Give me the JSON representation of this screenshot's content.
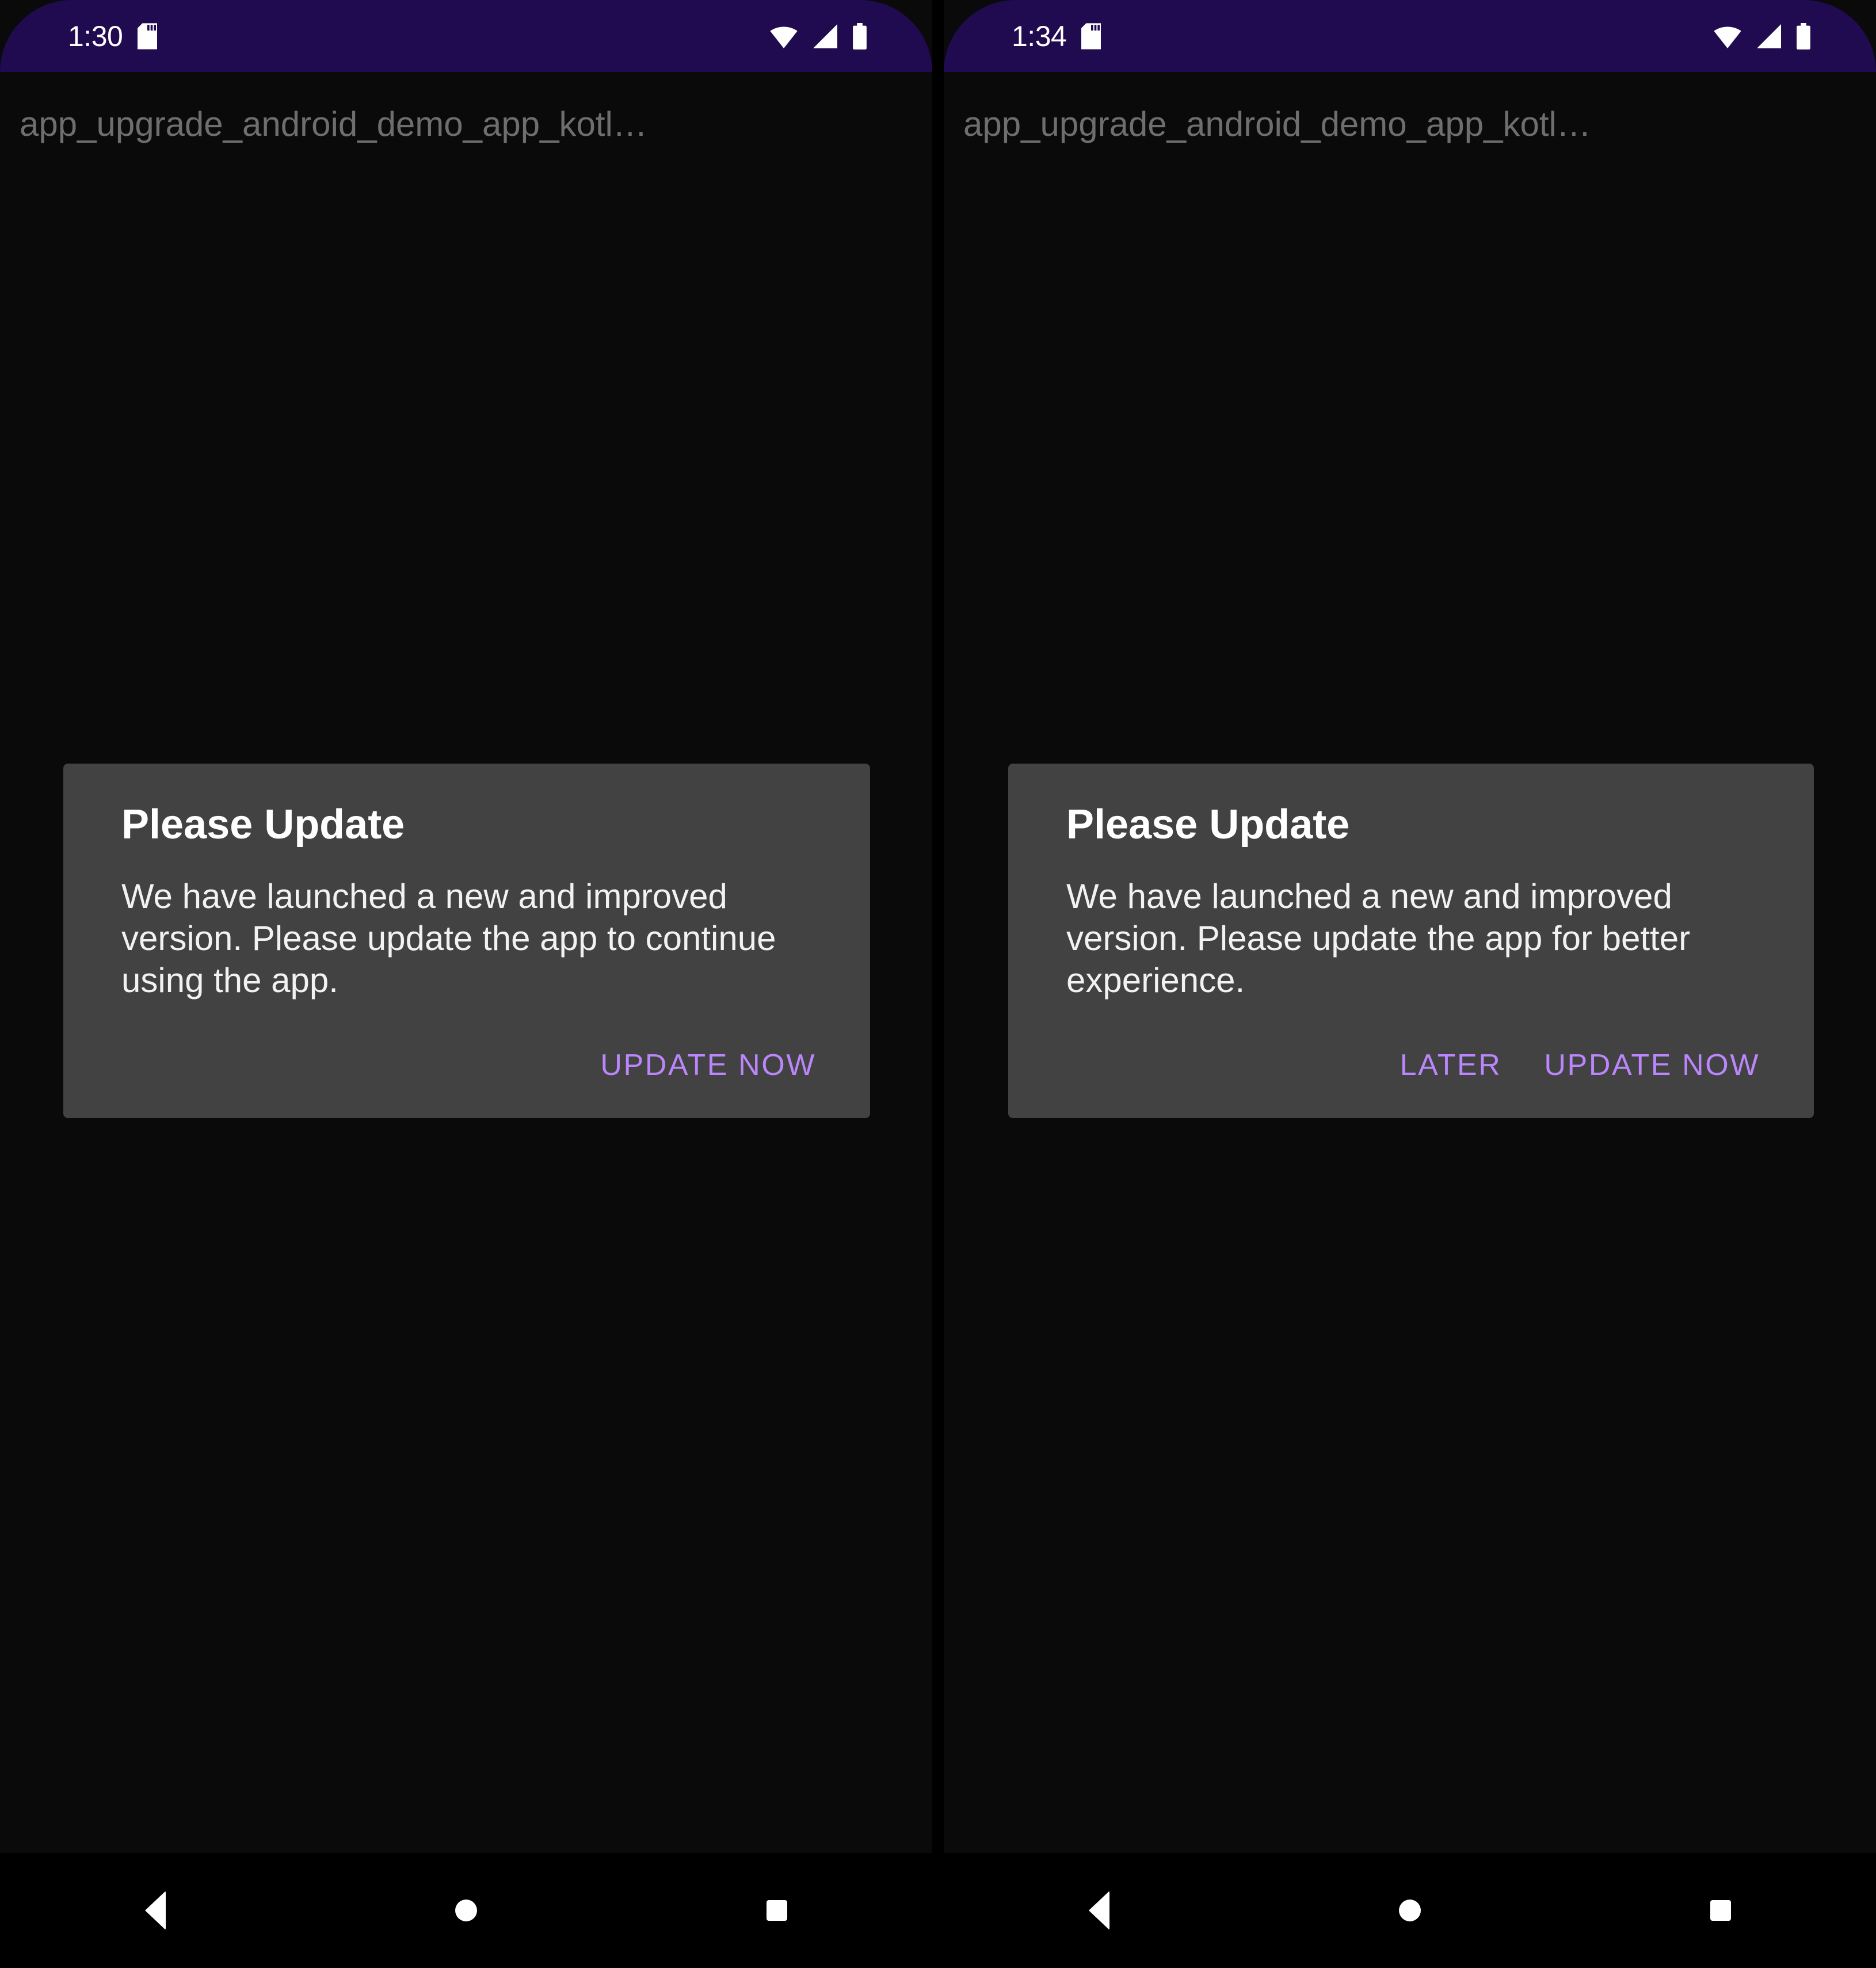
{
  "screens": [
    {
      "id": "screen-forced-update",
      "status_bar": {
        "time": "1:30",
        "icons": [
          "sd-card-icon",
          "wifi-icon",
          "cellular-signal-icon",
          "battery-icon"
        ],
        "background_color": "#200A50"
      },
      "app_title": "app_upgrade_android_demo_app_kotl…",
      "dialog": {
        "title": "Please Update",
        "message": "We have launched a new and improved version. Please update the app to continue using the app.",
        "background_color": "#424242",
        "buttons": [
          {
            "label": "UPDATE NOW",
            "color": "#BB86FC"
          }
        ]
      }
    },
    {
      "id": "screen-optional-update",
      "status_bar": {
        "time": "1:34",
        "icons": [
          "sd-card-icon",
          "wifi-icon",
          "cellular-signal-icon",
          "battery-icon"
        ],
        "background_color": "#200A50"
      },
      "app_title": "app_upgrade_android_demo_app_kotl…",
      "dialog": {
        "title": "Please Update",
        "message": "We have launched a new and improved version. Please update the app for better experience.",
        "background_color": "#424242",
        "buttons": [
          {
            "label": "LATER",
            "color": "#BB86FC"
          },
          {
            "label": "UPDATE NOW",
            "color": "#BB86FC"
          }
        ]
      }
    }
  ],
  "navigation_bar": {
    "background_color": "#000000",
    "buttons": [
      {
        "name": "back",
        "icon": "back-triangle-icon"
      },
      {
        "name": "home",
        "icon": "home-circle-icon"
      },
      {
        "name": "recents",
        "icon": "recents-square-icon"
      }
    ]
  }
}
